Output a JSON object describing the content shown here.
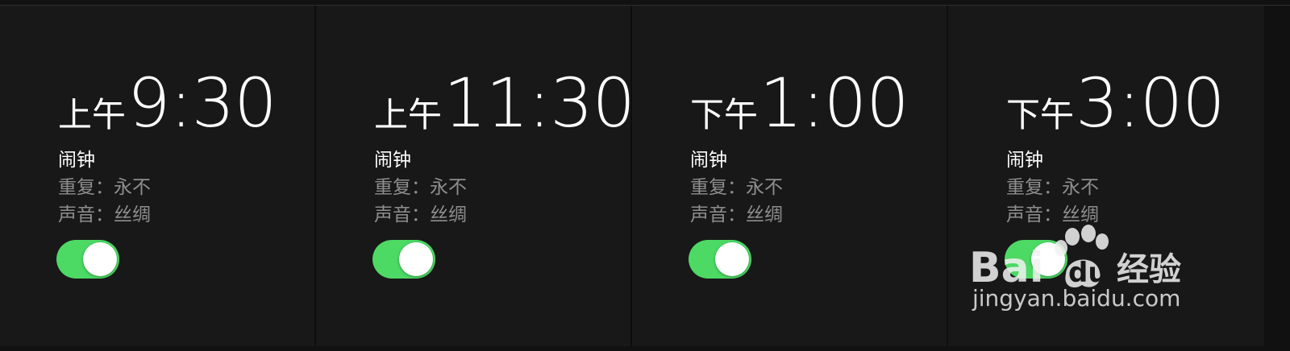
{
  "alarms": [
    {
      "meridiem": "上午",
      "time": "9:30",
      "label": "闹钟",
      "repeat": "重复：永不",
      "sound": "声音：丝绸",
      "enabled": true
    },
    {
      "meridiem": "上午",
      "time": "11:30",
      "label": "闹钟",
      "repeat": "重复：永不",
      "sound": "声音：丝绸",
      "enabled": true
    },
    {
      "meridiem": "下午",
      "time": "1:00",
      "label": "闹钟",
      "repeat": "重复：永不",
      "sound": "声音：丝绸",
      "enabled": true
    },
    {
      "meridiem": "下午",
      "time": "3:00",
      "label": "闹钟",
      "repeat": "重复：永不",
      "sound": "声音：丝绸",
      "enabled": true
    }
  ],
  "colors": {
    "background": "#181818",
    "toggle_on": "#4cd964",
    "primary_text": "#ffffff",
    "secondary_text": "#8e8e8e"
  },
  "watermark": {
    "brand": "Bai du 经验",
    "url": "jingyan.baidu.com"
  }
}
